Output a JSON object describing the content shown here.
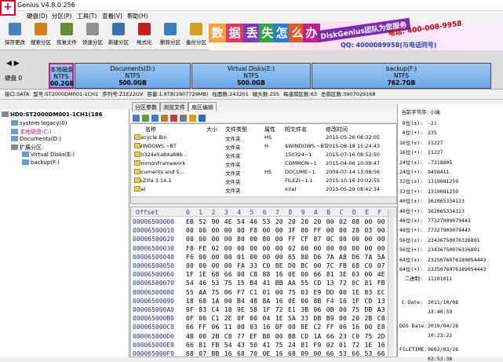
{
  "titlebar": {
    "title": "Genius V4.8.0.256"
  },
  "menu": [
    "硬盘(D)",
    "分区(P)",
    "工具(T)",
    "查看(V)",
    "帮助(H)"
  ],
  "toolbar": {
    "buttons": [
      {
        "label": "保存更改",
        "icon": "save-icon",
        "color": "#4a7fc0"
      },
      {
        "label": "搜索分区",
        "icon": "search-icon",
        "color": "#d08020"
      },
      {
        "label": "恢复文件",
        "icon": "recover-icon",
        "color": "#6a8a3a"
      },
      {
        "label": "快速分区",
        "icon": "quick-partition-icon",
        "color": "#909090"
      },
      {
        "label": "新建分区",
        "icon": "new-partition-icon",
        "color": "#3a70b0"
      },
      {
        "label": "格式化",
        "icon": "format-icon",
        "color": "#c02020"
      },
      {
        "label": "删除分区",
        "icon": "delete-icon",
        "color": "#3a80c0"
      },
      {
        "label": "备份分区",
        "icon": "backup-icon",
        "color": "#d0a020"
      }
    ]
  },
  "ad": {
    "chars": [
      "数",
      "据",
      "丢",
      "失",
      "怎",
      "么",
      "办"
    ],
    "brand": "DiskGenius团队为您服务",
    "phone": "电话: 400-008-9958",
    "qq": "QQ: 4000089958(与电话同号)"
  },
  "diskbar": {
    "nav": "◀ ▶",
    "disk_label": "硬盘 0",
    "partitions": [
      {
        "name": "本地磁盘(C:)",
        "fs": "NTFS",
        "size": "00.2GB"
      },
      {
        "name": "Documents(D:)",
        "fs": "NTFS",
        "size": "500.0GB"
      },
      {
        "name": "Virtual Disks(E:)",
        "fs": "NTFS",
        "size": "500.0GB"
      },
      {
        "name": "backup(F:)",
        "fs": "NTFS",
        "size": "762.7GB"
      }
    ]
  },
  "infobar": [
    "接口:SATA",
    "型号:ST2000DM001-1CH1",
    "序列号:Z1E22GV",
    "容量:1.8TB(1907729MB)",
    "柱面数:243201",
    "磁头数:255",
    "每道扇区数:63",
    "总扇区数:3907029168"
  ],
  "tree": {
    "disk": "HD0:ST2000DM001-1CH1(186",
    "items": [
      {
        "label": "system legacy(0)",
        "color": "#333"
      },
      {
        "label": "本地磁盘(C:)",
        "color": "#c02060"
      },
      {
        "label": "Documents(D:)",
        "color": "#333"
      },
      {
        "label": "扩展分区",
        "color": "#333"
      },
      {
        "label": "Virtual Disks(E:)",
        "color": "#333"
      },
      {
        "label": "backup(F:)",
        "color": "#333"
      }
    ]
  },
  "tabs": [
    "分区参数",
    "浏览文件",
    "扇区编辑"
  ],
  "filelist": {
    "columns": [
      "名称",
      "大小",
      "文件类型",
      "属性",
      "短文件名",
      "修改时间"
    ],
    "rows": [
      {
        "name": "$Recycle.Bin",
        "type": "文件夹",
        "attr": "HS",
        "short": "",
        "mtime": "2015-05-26 08:32:05"
      },
      {
        "name": "$WINDOWS.~BT",
        "type": "文件夹",
        "attr": "H",
        "short": "$WINDOWS.~BT",
        "mtime": "2015-08-18 15:24:43"
      },
      {
        "name": "150324e5a84a88b...",
        "type": "文件夹",
        "attr": "",
        "short": "150324~1",
        "mtime": "2015-07-16 08:52:50"
      },
      {
        "name": "CommonFramework",
        "type": "文件夹",
        "attr": "",
        "short": "COMMON~1",
        "mtime": "2015-04-06 10:09:47"
      },
      {
        "name": "Documents and S...",
        "type": "文件夹",
        "attr": "HS",
        "short": "DOCUME~1",
        "mtime": "2009-07-14 13:08:56"
      },
      {
        "name": "FileZilla 3.14.1",
        "type": "文件夹",
        "attr": "",
        "short": "FILEZI~1.1",
        "mtime": "2015-10-16 10:02:55"
      },
      {
        "name": "Intel",
        "type": "文件夹",
        "attr": "",
        "short": "Intel",
        "mtime": "2015-05-29 08:42:34"
      }
    ]
  },
  "hex": {
    "header": [
      "Offset",
      "0",
      "1",
      "2",
      "3",
      "4",
      "5",
      "6",
      "7",
      "8",
      "9",
      "A",
      "B",
      "C",
      "D",
      "E",
      "F"
    ],
    "rows": [
      {
        "off": "00006500000",
        "bytes": "EB 52 90 4E 54 46 53 20 20 20 20 00 02 08 00 00"
      },
      {
        "off": "00006500010",
        "bytes": "00 00 00 00 00 F8 00 00 3F 00 FF 00 00 28 03 00"
      },
      {
        "off": "00006500020",
        "bytes": "00 00 00 00 80 00 80 00 FF CF 87 0C 00 00 00 00"
      },
      {
        "off": "00006500030",
        "bytes": "F8 FE 02 00 00 00 00 00 02 00 00 00 00 00 00 00"
      },
      {
        "off": "00006500040",
        "bytes": "F6 00 00 00 01 00 00 00 65 80 D6 7A A8 D6 7A 5A"
      },
      {
        "off": "00006500050",
        "bytes": "00 00 00 00 FA 33 C0 8E D0 BC 00 7C FB 68 C0 07"
      },
      {
        "off": "00006500060",
        "bytes": "1F 1E 68 66 00 CB 88 16 0E 00 66 81 3E 03 00 4E"
      },
      {
        "off": "00006500070",
        "bytes": "54 46 53 75 15 B4 41 BB AA 55 CD 13 72 0C 81 FB"
      },
      {
        "off": "00006500080",
        "bytes": "55 AA 75 06 F7 C1 01 00 75 03 E9 DD 00 1E 83 EC"
      },
      {
        "off": "00006500090",
        "bytes": "18 68 1A 00 B4 48 8A 16 0E 00 8B F4 16 1F CD 13"
      },
      {
        "off": "000065000A0",
        "bytes": "9F 83 C4 18 9E 58 1F 72 E1 3B 06 0B 00 75 DB A3"
      },
      {
        "off": "000065000B0",
        "bytes": "0F 00 C1 2E 0F 00 04 1E 5A 33 DB B9 00 20 2B C8"
      },
      {
        "off": "000065000C0",
        "bytes": "66 FF 06 11 00 03 16 0F 00 8E C2 FF 06 16 00 E8"
      },
      {
        "off": "000065000D0",
        "bytes": "4B 00 2B C8 77 EF B8 00 BB CD 1A 66 23 C0 75 2D"
      },
      {
        "off": "000065000E0",
        "bytes": "66 81 FB 54 43 50 41 75 24 81 F9 02 01 72 1E 16"
      },
      {
        "off": "000065000F0",
        "bytes": "68 07 BB 16 68 70 0E 16 68 09 00 66 53 66 53 66"
      }
    ]
  },
  "panel": {
    "title": "当前字节序: 小端",
    "rows": [
      {
        "k": "8位(±):",
        "v": "-21"
      },
      {
        "k": "8位(+):",
        "v": "235"
      },
      {
        "k": "16位(±):",
        "v": "21227"
      },
      {
        "k": "16位(+):",
        "v": "21227"
      },
      {
        "k": "24位(±):",
        "v": "-7318805"
      },
      {
        "k": "24位(+):",
        "v": "9458411"
      },
      {
        "k": "32位(±):",
        "v": "1319081259"
      },
      {
        "k": "32位(+):",
        "v": "1319081259"
      },
      {
        "k": "40位(±):",
        "v": "362065334123"
      },
      {
        "k": "40位(+):",
        "v": "362065334123"
      },
      {
        "k": "48位(±):",
        "v": "77327909079443"
      },
      {
        "k": "48位(+):",
        "v": "77327909079443"
      },
      {
        "k": "56位(±):",
        "v": "23436750076326891"
      },
      {
        "k": "56位(+):",
        "v": "23436750076326891"
      },
      {
        "k": "64位(±):",
        "v": "2325076076189054443"
      },
      {
        "k": "64位(+):",
        "v": "2325076076189054443"
      },
      {
        "k": "二进制:",
        "v": "11101011"
      }
    ],
    "dates": [
      {
        "k": "C Date:",
        "v": "2011/10/08",
        "t": "13:40:59"
      },
      {
        "k": "DOS Date:",
        "v": "2019/04/26",
        "t": "10:23:22"
      },
      {
        "k": "FILETIME:",
        "v": "9602/03/26",
        "t": "02:53:38"
      }
    ]
  }
}
